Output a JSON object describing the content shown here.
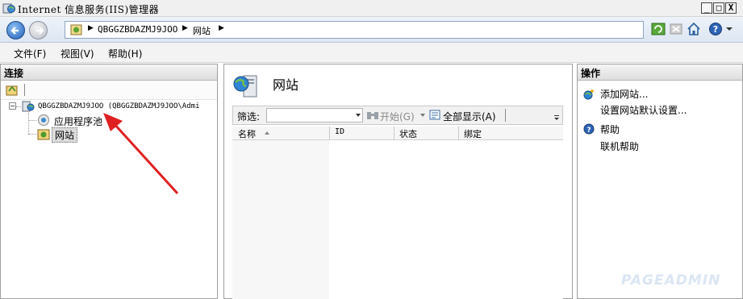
{
  "window": {
    "title": "Internet 信息服务(IIS)管理器",
    "buttons": {
      "minimize": "_",
      "maximize": "□",
      "close": "X"
    }
  },
  "address": {
    "crumbs": [
      "QBGGZBDAZMJ9JOO",
      "网站"
    ],
    "separator": "▶"
  },
  "menu": {
    "items": [
      "文件(F)",
      "视图(V)",
      "帮助(H)"
    ]
  },
  "connections": {
    "header": "连接",
    "tree": {
      "server": "QBGGZBDAZMJ9JOO (QBGGZBDAZMJ9JOO\\Admi",
      "app_pools": "应用程序池",
      "sites": "网站"
    }
  },
  "center": {
    "title": "网站",
    "filter": {
      "label": "筛选:",
      "input_value": "",
      "start_label": "开始(G)",
      "show_all_label": "全部显示(A)"
    },
    "columns": [
      "名称",
      "ID",
      "状态",
      "绑定"
    ]
  },
  "actions": {
    "header": "操作",
    "add_site": "添加网站...",
    "set_defaults": "设置网站默认设置...",
    "help": "帮助",
    "online_help": "联机帮助"
  },
  "watermark": "PAGEADMIN",
  "colors": {
    "annotation_arrow": "#e02020",
    "selected_bg": "#dcdcdc"
  }
}
